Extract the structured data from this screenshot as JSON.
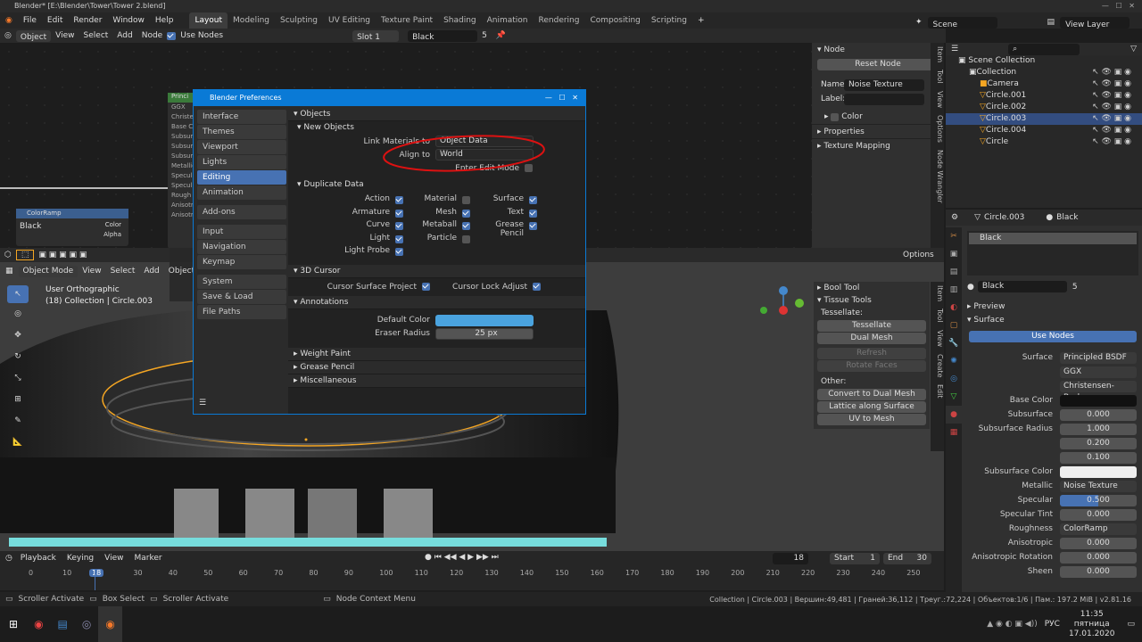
{
  "window": {
    "title": "Blender* [E:\\Blender\\Tower\\Tower 2.blend]"
  },
  "menu": [
    "File",
    "Edit",
    "Render",
    "Window",
    "Help"
  ],
  "workspaces": [
    "Layout",
    "Modeling",
    "Sculpting",
    "UV Editing",
    "Texture Paint",
    "Shading",
    "Animation",
    "Rendering",
    "Compositing",
    "Scripting"
  ],
  "scene": {
    "label": "Scene",
    "view_layer": "View Layer"
  },
  "node_header": {
    "object": "Object",
    "view": "View",
    "select": "Select",
    "add": "Add",
    "node": "Node",
    "use_nodes": "Use Nodes",
    "slot": "Slot 1",
    "material": "Black",
    "users": "5"
  },
  "node_sidebar": {
    "panel": "Node",
    "reset": "Reset Node",
    "name_label": "Name:",
    "name_value": "Noise Texture",
    "label_label": "Label:",
    "color": "Color",
    "properties": "Properties",
    "texture_mapping": "Texture Mapping",
    "tabs": [
      "Item",
      "Tool",
      "View",
      "Options",
      "Node Wrangler"
    ]
  },
  "nodes": {
    "principled": "Princi",
    "colorramp": "ColorRamp",
    "cr_value": "Black",
    "cr_color": "Color",
    "cr_alpha": "Alpha",
    "pr_rows": [
      "GGX",
      "Christen",
      "Base C",
      "Subsurf",
      "Subsurf",
      "Subsurf",
      "Metallic",
      "Specul",
      "Specul",
      "Rough",
      "Anisotr",
      "Anisotr"
    ]
  },
  "outliner": {
    "root": "Scene Collection",
    "items": [
      {
        "name": "Collection",
        "indent": 1,
        "sel": false
      },
      {
        "name": "Camera",
        "indent": 2,
        "sel": false
      },
      {
        "name": "Circle.001",
        "indent": 2,
        "sel": false
      },
      {
        "name": "Circle.002",
        "indent": 2,
        "sel": false
      },
      {
        "name": "Circle.003",
        "indent": 2,
        "sel": true
      },
      {
        "name": "Circle.004",
        "indent": 2,
        "sel": false
      },
      {
        "name": "Circle",
        "indent": 2,
        "sel": false
      }
    ]
  },
  "props": {
    "object": "Circle.003",
    "material": "Black",
    "slot_item": "Black",
    "mat_name": "Black",
    "users": "5",
    "preview": "Preview",
    "surface": "Surface",
    "use_nodes": "Use Nodes",
    "rows": [
      {
        "label": "Surface",
        "value": "Principled BSDF",
        "link": true
      },
      {
        "label": "",
        "value": "GGX",
        "link": true
      },
      {
        "label": "",
        "value": "Christensen-Burley",
        "link": true
      },
      {
        "label": "Base Color",
        "value": "",
        "link": false,
        "dark": true
      },
      {
        "label": "Subsurface",
        "value": "0.000",
        "link": false
      },
      {
        "label": "Subsurface Radius",
        "value": "1.000",
        "link": false
      },
      {
        "label": "",
        "value": "0.200",
        "link": false
      },
      {
        "label": "",
        "value": "0.100",
        "link": false
      },
      {
        "label": "Subsurface Color",
        "value": "",
        "link": false,
        "white": true
      },
      {
        "label": "Metallic",
        "value": "Noise Texture",
        "link": true
      },
      {
        "label": "Specular",
        "value": "0.500",
        "link": false,
        "blue": true
      },
      {
        "label": "Specular Tint",
        "value": "0.000",
        "link": false
      },
      {
        "label": "Roughness",
        "value": "ColorRamp",
        "link": true
      },
      {
        "label": "Anisotropic",
        "value": "0.000",
        "link": false
      },
      {
        "label": "Anisotropic Rotation",
        "value": "0.000",
        "link": false
      },
      {
        "label": "Sheen",
        "value": "0.000",
        "link": false
      }
    ]
  },
  "viewport": {
    "mode": "Object Mode",
    "view": "View",
    "select": "Select",
    "add": "Add",
    "object": "Object",
    "overlay1": "User Orthographic",
    "overlay2": "(18) Collection | Circle.003",
    "options": "Options"
  },
  "tissue": {
    "bool_tool": "Bool Tool",
    "tissue_tools": "Tissue Tools",
    "tessellate_lbl": "Tessellate:",
    "tessellate": "Tessellate",
    "dual_mesh": "Dual Mesh",
    "refresh": "Refresh",
    "rotate": "Rotate Faces",
    "other": "Other:",
    "convert": "Convert to Dual Mesh",
    "lattice": "Lattice along Surface",
    "uv": "UV to Mesh",
    "tabs": [
      "Item",
      "Tool",
      "View",
      "Create",
      "Edit"
    ]
  },
  "prefs": {
    "title": "Blender Preferences",
    "nav": [
      {
        "label": "Interface",
        "sel": false
      },
      {
        "label": "Themes",
        "sel": false
      },
      {
        "label": "Viewport",
        "sel": false
      },
      {
        "label": "Lights",
        "sel": false
      },
      {
        "label": "Editing",
        "sel": true
      },
      {
        "label": "Animation",
        "sel": false
      },
      {
        "gap": true
      },
      {
        "label": "Add-ons",
        "sel": false
      },
      {
        "gap": true
      },
      {
        "label": "Input",
        "sel": false
      },
      {
        "label": "Navigation",
        "sel": false
      },
      {
        "label": "Keymap",
        "sel": false
      },
      {
        "gap": true
      },
      {
        "label": "System",
        "sel": false
      },
      {
        "label": "Save & Load",
        "sel": false
      },
      {
        "label": "File Paths",
        "sel": false
      }
    ],
    "objects": "Objects",
    "new_objects": "New Objects",
    "link_materials_label": "Link Materials to",
    "link_materials_value": "Object Data",
    "align_label": "Align to",
    "align_value": "World",
    "enter_edit": "Enter Edit Mode",
    "duplicate_data": "Duplicate Data",
    "dup": [
      [
        {
          "l": "Action",
          "on": true
        },
        {
          "l": "Material",
          "on": false
        },
        {
          "l": "Surface",
          "on": true
        }
      ],
      [
        {
          "l": "Armature",
          "on": true
        },
        {
          "l": "Mesh",
          "on": true
        },
        {
          "l": "Text",
          "on": true
        }
      ],
      [
        {
          "l": "Curve",
          "on": true
        },
        {
          "l": "Metaball",
          "on": true
        },
        {
          "l": "Grease Pencil",
          "on": true
        }
      ],
      [
        {
          "l": "Light",
          "on": true
        },
        {
          "l": "Particle",
          "on": false
        },
        {
          "l": "",
          "on": null
        }
      ],
      [
        {
          "l": "Light Probe",
          "on": true
        },
        {
          "l": "",
          "on": null
        },
        {
          "l": "",
          "on": null
        }
      ]
    ],
    "cursor3d": "3D Cursor",
    "cursor_project": "Cursor Surface Project",
    "cursor_lock": "Cursor Lock Adjust",
    "annotations": "Annotations",
    "default_color": "Default Color",
    "eraser_radius": "Eraser Radius",
    "eraser_value": "25 px",
    "weight_paint": "Weight Paint",
    "grease_pencil": "Grease Pencil",
    "misc": "Miscellaneous"
  },
  "timeline": {
    "playback": "Playback",
    "keying": "Keying",
    "view": "View",
    "marker": "Marker",
    "current": "18",
    "start_label": "Start",
    "start": "1",
    "end_label": "End",
    "end": "30",
    "ticks": [
      "0",
      "10",
      "18",
      "30",
      "40",
      "50",
      "60",
      "70",
      "80",
      "90",
      "100",
      "110",
      "120",
      "130",
      "140",
      "150",
      "160",
      "170",
      "180",
      "190",
      "200",
      "210",
      "220",
      "230",
      "240",
      "250"
    ]
  },
  "status": {
    "left1": "Scroller Activate",
    "left2": "Box Select",
    "left3": "Scroller Activate",
    "mid": "Node Context Menu",
    "right": "Collection | Circle.003 | Вершин:49,481 | Граней:36,112 | Треуг.:72,224 | Объектов:1/6 | Пам.: 197.2 MiB | v2.81.16"
  },
  "taskbar": {
    "lang": "РУС",
    "time": "11:35",
    "day": "пятница",
    "date": "17.01.2020"
  },
  "colors": {
    "accent": "#4772b3",
    "prefs_blue": "#0a7ad6",
    "orange": "#f5a623",
    "annotation_red": "#d11"
  }
}
